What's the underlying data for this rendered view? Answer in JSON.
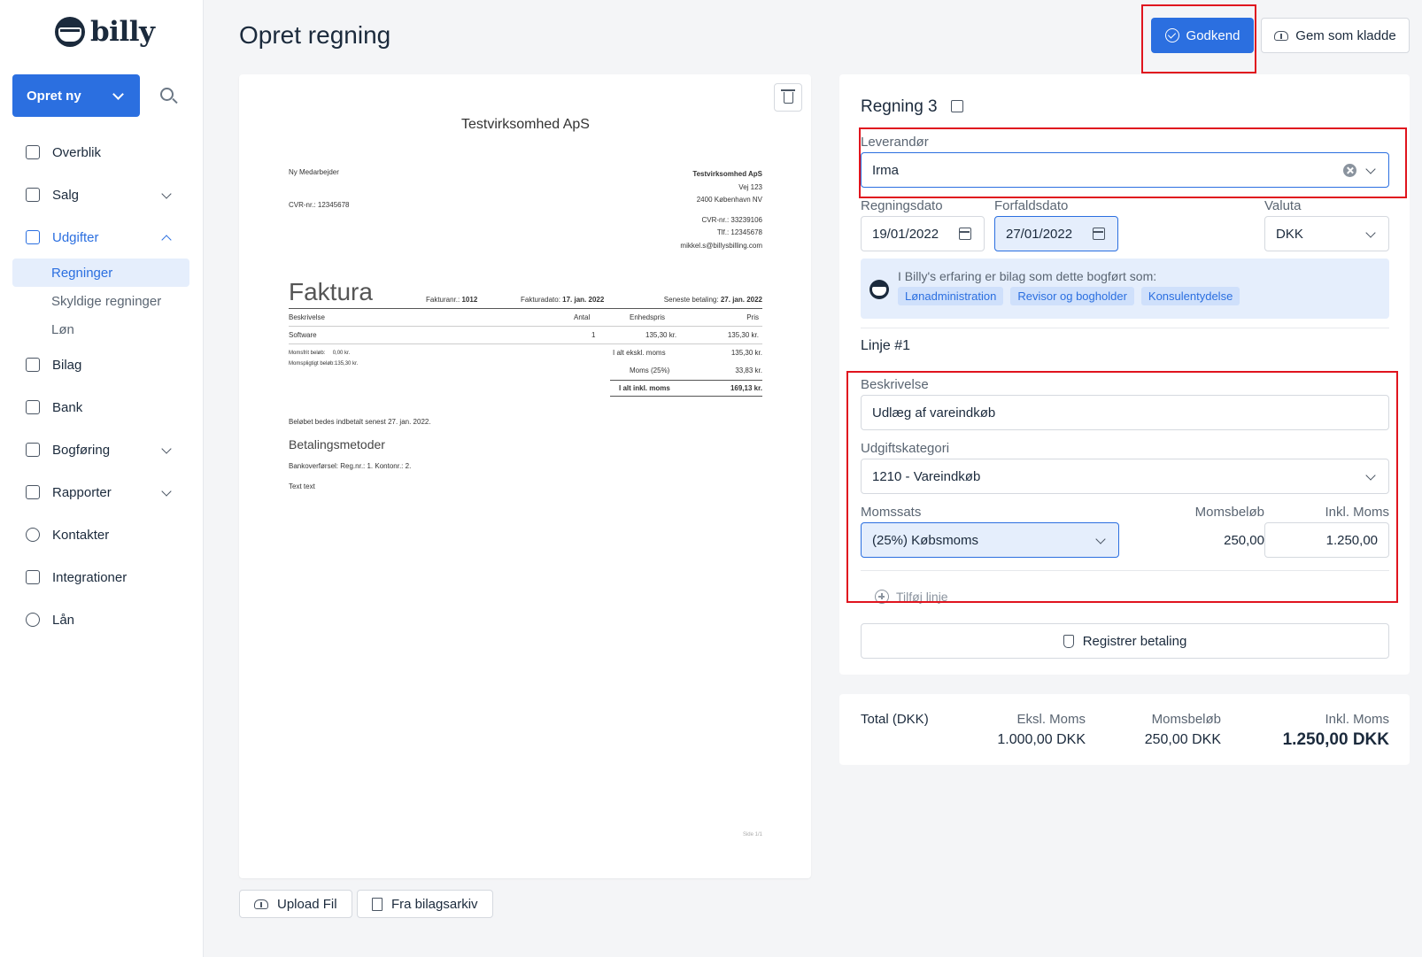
{
  "brand": {
    "name": "billy"
  },
  "sidebar": {
    "create_label": "Opret ny",
    "items": [
      {
        "label": "Overblik"
      },
      {
        "label": "Salg"
      },
      {
        "label": "Udgifter"
      },
      {
        "label": "Bilag"
      },
      {
        "label": "Bank"
      },
      {
        "label": "Bogføring"
      },
      {
        "label": "Rapporter"
      },
      {
        "label": "Kontakter"
      },
      {
        "label": "Integrationer"
      },
      {
        "label": "Lån"
      }
    ],
    "sub_items": [
      {
        "label": "Regninger"
      },
      {
        "label": "Skyldige regninger"
      },
      {
        "label": "Løn"
      }
    ]
  },
  "header": {
    "title": "Opret regning",
    "approve_label": "Godkend",
    "draft_label": "Gem som kladde"
  },
  "document": {
    "company": "Testvirksomhed ApS",
    "recipient": "Ny Medarbejder",
    "recipient_cvr": "CVR-nr.: 12345678",
    "sender_lines": [
      "Testvirksomhed ApS",
      "Vej 123",
      "2400 København NV",
      "",
      "CVR-nr.: 33239106",
      "Tlf.: 12345678",
      "mikkel.s@billysbilling.com"
    ],
    "heading": "Faktura",
    "invoice_no_label": "Fakturanr.:",
    "invoice_no": "1012",
    "invoice_date_label": "Fakturadato:",
    "invoice_date": "17. jan. 2022",
    "due_label": "Seneste betaling:",
    "due_date": "27. jan. 2022",
    "cols": {
      "desc": "Beskrivelse",
      "qty": "Antal",
      "unit": "Enhedspris",
      "price": "Pris"
    },
    "row": {
      "desc": "Software",
      "qty": "1",
      "unit": "135,30 kr.",
      "price": "135,30 kr."
    },
    "vat_free_label": "Momsfrit beløb:",
    "vat_free": "0,00 kr.",
    "vat_liable_label": "Momspligtigt beløb:",
    "vat_liable": "135,30 kr.",
    "sum_excl_label": "I alt ekskl. moms",
    "sum_excl": "135,30 kr.",
    "vat_label": "Moms (25%)",
    "vat": "33,83 kr.",
    "sum_incl_label": "I alt inkl. moms",
    "sum_incl": "169,13 kr.",
    "pay_note": "Beløbet bedes indbetalt senest 27. jan. 2022.",
    "methods_heading": "Betalingsmetoder",
    "methods_line": "Bankoverførsel: Reg.nr.: 1. Kontonr.: 2.",
    "extra_text": "Text text",
    "page_no": "Side 1/1"
  },
  "doc_actions": {
    "upload_label": "Upload Fil",
    "archive_label": "Fra bilagsarkiv"
  },
  "form": {
    "bill_title": "Regning 3",
    "vendor_label": "Leverandør",
    "vendor_value": "Irma",
    "bill_date_label": "Regningsdato",
    "bill_date": "19/01/2022",
    "due_date_label": "Forfaldsdato",
    "due_date": "27/01/2022",
    "currency_label": "Valuta",
    "currency": "DKK",
    "hint_text": "I Billy's erfaring er bilag som dette bogført som:",
    "hint_tags": [
      "Lønadministration",
      "Revisor og bogholder",
      "Konsulentydelse"
    ],
    "line_title": "Linje #1",
    "desc_label": "Beskrivelse",
    "desc_value": "Udlæg af vareindkøb",
    "category_label": "Udgiftskategori",
    "category_value": "1210 -  Vareindkøb",
    "vat_rate_label": "Momssats",
    "vat_rate_value": "(25%) Købsmoms",
    "vat_amount_label": "Momsbeløb",
    "vat_amount_value": "250,00",
    "incl_label": "Inkl. Moms",
    "incl_value": "1.250,00",
    "add_line_label": "Tilføj linje",
    "pay_label": "Registrer betaling"
  },
  "totals": {
    "label": "Total (DKK)",
    "excl_label": "Eksl. Moms",
    "excl_value": "1.000,00 DKK",
    "vat_label": "Momsbeløb",
    "vat_value": "250,00 DKK",
    "incl_label": "Inkl. Moms",
    "incl_value": "1.250,00 DKK"
  }
}
